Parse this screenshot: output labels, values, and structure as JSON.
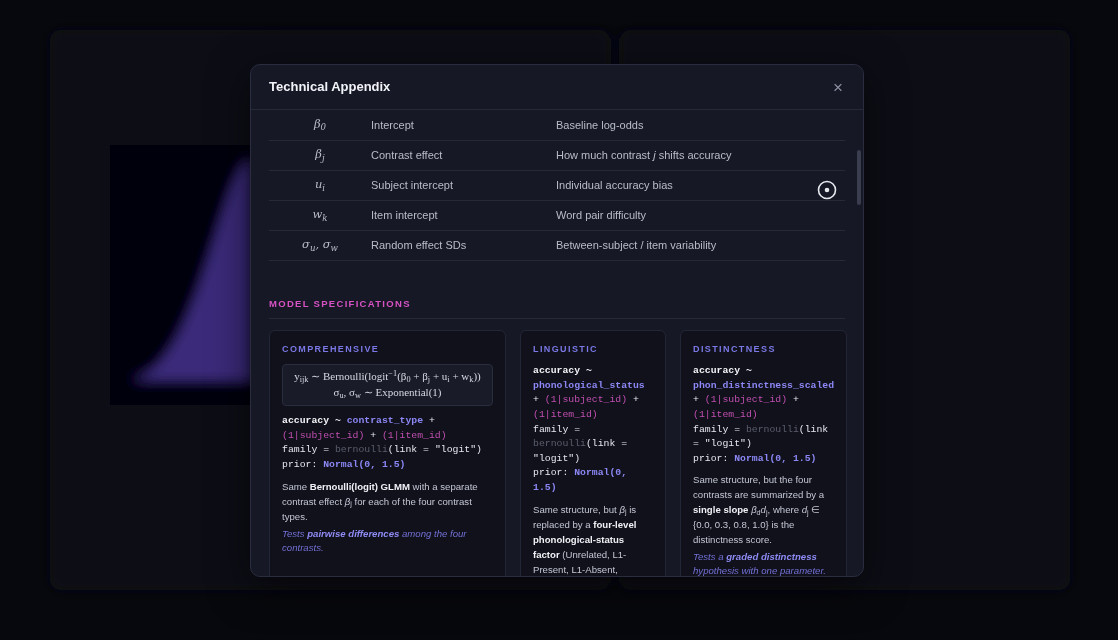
{
  "modal": {
    "title": "Technical Appendix",
    "close": "×"
  },
  "parameters": [
    {
      "symbol": "β$_{0}$",
      "name": "Intercept",
      "description": "Baseline log-odds"
    },
    {
      "symbol": "β$_{j}$",
      "name": "Contrast effect",
      "description": "How much contrast *j* shifts accuracy"
    },
    {
      "symbol": "u$_{i}$",
      "name": "Subject intercept",
      "description": "Individual accuracy bias"
    },
    {
      "symbol": "w$_{k}$",
      "name": "Item intercept",
      "description": "Word pair difficulty"
    },
    {
      "symbol": "σ$_{u}$, σ$_{w}$",
      "name": "Random effect SDs",
      "description": "Between-subject / item variability"
    }
  ],
  "section_title": "MODEL SPECIFICATIONS",
  "models": [
    {
      "title": "COMPREHENSIVE",
      "equations": [
        "y$_{ijk}$ ∼ Bernoulli(logit$^{−1}$(β$_{0}$ + β$_{j}$ + u$_{i}$ + w$_{k}$))",
        "σ$_{u}$, σ$_{w}$ ∼ Exponential(1)"
      ],
      "code": [
        {
          "kind": "lhs",
          "text": "accuracy ~ "
        },
        {
          "kind": "term",
          "text": "contrast_type"
        },
        {
          "kind": "plain",
          "text": " + "
        },
        {
          "kind": "random",
          "text": "(1|subject_id)"
        },
        {
          "kind": "plain",
          "text": " + "
        },
        {
          "kind": "random",
          "text": "(1|item_id)"
        },
        {
          "kind": "break",
          "text": "family = "
        },
        {
          "kind": "muted",
          "text": "bernoulli"
        },
        {
          "kind": "plain",
          "text": "(link = \"logit\")"
        },
        {
          "kind": "break",
          "text": "prior: "
        },
        {
          "kind": "term",
          "text": "Normal(0, 1.5)"
        }
      ],
      "description": "Same **Bernoulli(logit) GLMM** with a separate contrast effect *β*$_{j}$ for each of the four contrast types.",
      "note": "Tests **pairwise differences** among the four contrasts."
    },
    {
      "title": "LINGUISTIC",
      "code": [
        {
          "kind": "lhs",
          "text": "accuracy ~ "
        },
        {
          "kind": "term",
          "text": "phonological_status"
        },
        {
          "kind": "plain",
          "text": " + "
        },
        {
          "kind": "random",
          "text": "(1|subject_id)"
        },
        {
          "kind": "plain",
          "text": " + "
        },
        {
          "kind": "random",
          "text": "(1|item_id)"
        },
        {
          "kind": "break",
          "text": "family = "
        },
        {
          "kind": "muted",
          "text": "bernoulli"
        },
        {
          "kind": "plain",
          "text": "(link = \"logit\")"
        },
        {
          "kind": "break",
          "text": "prior: "
        },
        {
          "kind": "term",
          "text": "Normal(0, 1.5)"
        }
      ],
      "description": "Same structure, but *β*$_{j}$ is replaced by a **four-level phonological-status factor** (Unrelated, L1-Present, L1-Absent,"
    },
    {
      "title": "DISTINCTNESS",
      "code": [
        {
          "kind": "lhs",
          "text": "accuracy ~ "
        },
        {
          "kind": "term",
          "text": "phon_distinctness_scaled"
        },
        {
          "kind": "plain",
          "text": " + "
        },
        {
          "kind": "random",
          "text": "(1|subject_id)"
        },
        {
          "kind": "plain",
          "text": " + "
        },
        {
          "kind": "random",
          "text": "(1|item_id)"
        },
        {
          "kind": "break",
          "text": "family = "
        },
        {
          "kind": "muted",
          "text": "bernoulli"
        },
        {
          "kind": "plain",
          "text": "(link = \"logit\")"
        },
        {
          "kind": "break",
          "text": "prior: "
        },
        {
          "kind": "term",
          "text": "Normal(0, 1.5)"
        }
      ],
      "description": "Same structure, but the four contrasts are summarized by a **single slope** *β*$_{d}$*d*$_{j}$, where *d*$_{j}$ ∈ {0.0, 0.3, 0.8, 1.0} is the distinctness score.",
      "note": "Tests a **graded distinctness** hypothesis with one parameter."
    }
  ]
}
